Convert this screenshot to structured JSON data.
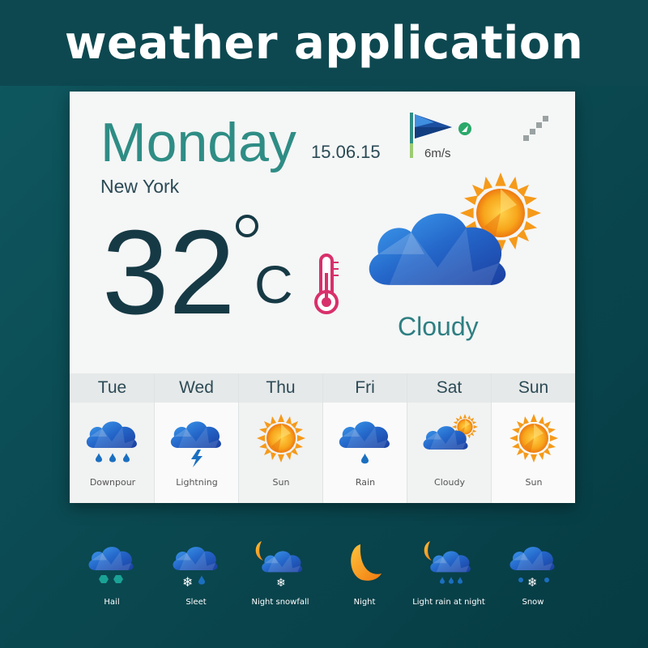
{
  "banner": {
    "title": "weather application"
  },
  "current": {
    "day": "Monday",
    "date": "15.06.15",
    "city": "New York",
    "temperature": "32",
    "unit": "C",
    "condition": "Cloudy",
    "wind": "6m/s"
  },
  "forecast": [
    {
      "day": "Tue",
      "label": "Downpour",
      "icon": "downpour-icon"
    },
    {
      "day": "Wed",
      "label": "Lightning",
      "icon": "lightning-icon"
    },
    {
      "day": "Thu",
      "label": "Sun",
      "icon": "sun-icon"
    },
    {
      "day": "Fri",
      "label": "Rain",
      "icon": "rain-icon"
    },
    {
      "day": "Sat",
      "label": "Cloudy",
      "icon": "cloudy-icon"
    },
    {
      "day": "Sun",
      "label": "Sun",
      "icon": "sun-icon"
    }
  ],
  "legend": [
    {
      "label": "Hail",
      "icon": "hail-icon"
    },
    {
      "label": "Sleet",
      "icon": "sleet-icon"
    },
    {
      "label": "Night snowfall",
      "icon": "night-snowfall-icon"
    },
    {
      "label": "Night",
      "icon": "moon-icon"
    },
    {
      "label": "Light rain at night",
      "icon": "light-rain-night-icon"
    },
    {
      "label": "Snow",
      "icon": "snow-icon"
    }
  ],
  "colors": {
    "accent": "#2e8d85",
    "text_dark": "#163a45",
    "cloud": "#2f7fd0",
    "sun": "#f6a11c"
  }
}
